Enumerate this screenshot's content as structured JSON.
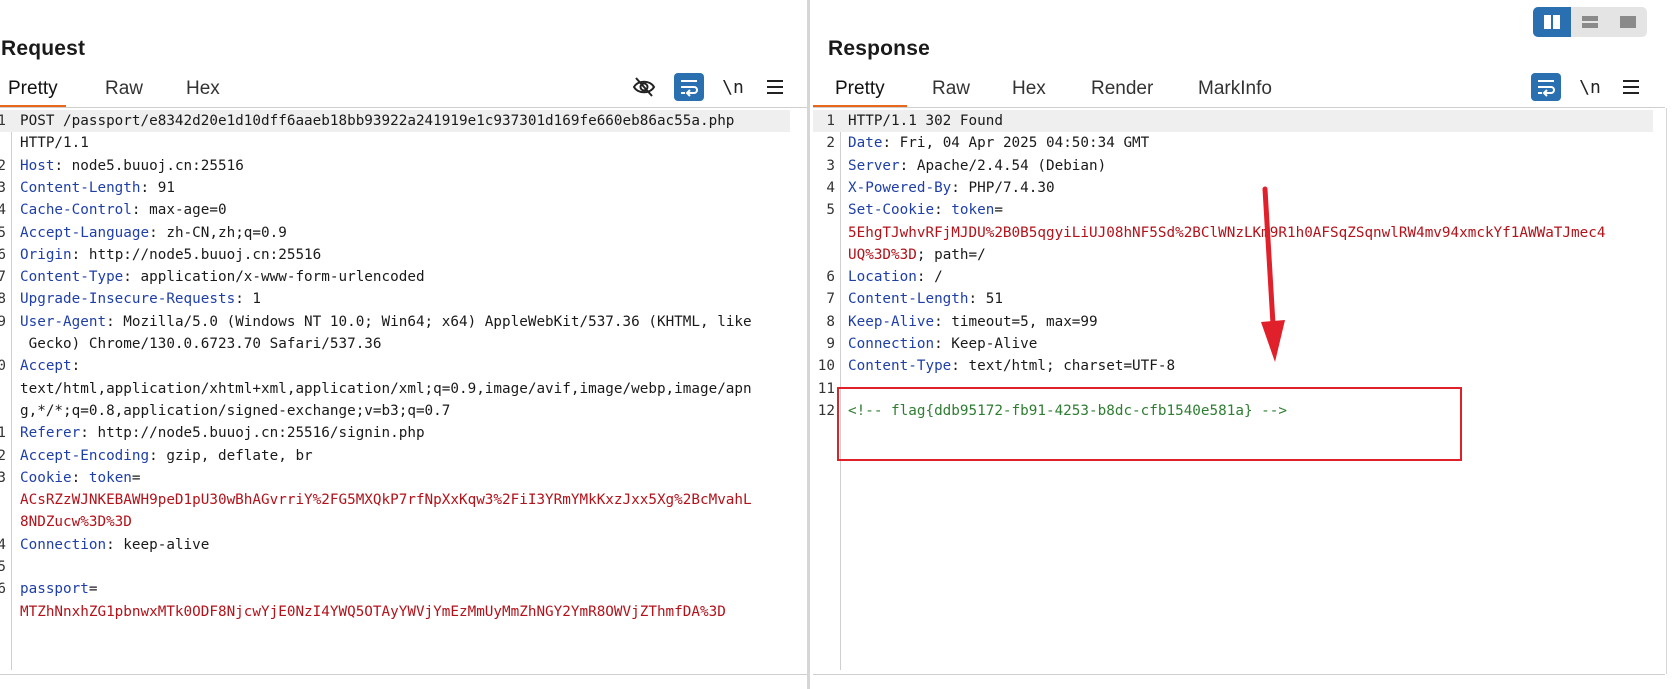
{
  "layout_controls": {
    "icons": [
      "split-vertical-icon",
      "split-horizontal-icon",
      "single-pane-icon"
    ]
  },
  "request": {
    "title": "Request",
    "tabs": [
      "Pretty",
      "Raw",
      "Hex"
    ],
    "active_tab": "Pretty",
    "tools": {
      "hide_icon": "eye-slash-icon",
      "wrap_icon": "word-wrap-icon",
      "newline_label": "\\n",
      "menu_icon": "hamburger-menu-icon"
    },
    "lines": [
      {
        "n": "1",
        "parts": [
          {
            "c": "v",
            "t": "POST /passport/e8342d20e1d10dff6aaeb18bb93922a241919e1c937301d169fe660eb86ac55a.php"
          }
        ]
      },
      {
        "n": "",
        "parts": [
          {
            "c": "v",
            "t": "HTTP/1.1"
          }
        ]
      },
      {
        "n": "2",
        "parts": [
          {
            "c": "k",
            "t": "Host"
          },
          {
            "c": "v",
            "t": ": node5.buuoj.cn:25516"
          }
        ]
      },
      {
        "n": "3",
        "parts": [
          {
            "c": "k",
            "t": "Content-Length"
          },
          {
            "c": "v",
            "t": ": 91"
          }
        ]
      },
      {
        "n": "4",
        "parts": [
          {
            "c": "k",
            "t": "Cache-Control"
          },
          {
            "c": "v",
            "t": ": max-age=0"
          }
        ]
      },
      {
        "n": "5",
        "parts": [
          {
            "c": "k",
            "t": "Accept-Language"
          },
          {
            "c": "v",
            "t": ": zh-CN,zh;q=0.9"
          }
        ]
      },
      {
        "n": "6",
        "parts": [
          {
            "c": "k",
            "t": "Origin"
          },
          {
            "c": "v",
            "t": ": http://node5.buuoj.cn:25516"
          }
        ]
      },
      {
        "n": "7",
        "parts": [
          {
            "c": "k",
            "t": "Content-Type"
          },
          {
            "c": "v",
            "t": ": application/x-www-form-urlencoded"
          }
        ]
      },
      {
        "n": "8",
        "parts": [
          {
            "c": "k",
            "t": "Upgrade-Insecure-Requests"
          },
          {
            "c": "v",
            "t": ": 1"
          }
        ]
      },
      {
        "n": "9",
        "parts": [
          {
            "c": "k",
            "t": "User-Agent"
          },
          {
            "c": "v",
            "t": ": Mozilla/5.0 (Windows NT 10.0; Win64; x64) AppleWebKit/537.36 (KHTML, like"
          }
        ]
      },
      {
        "n": "",
        "parts": [
          {
            "c": "v",
            "t": " Gecko) Chrome/130.0.6723.70 Safari/537.36"
          }
        ]
      },
      {
        "n": "10",
        "parts": [
          {
            "c": "k",
            "t": "Accept"
          },
          {
            "c": "v",
            "t": ":"
          }
        ]
      },
      {
        "n": "",
        "parts": [
          {
            "c": "v",
            "t": "text/html,application/xhtml+xml,application/xml;q=0.9,image/avif,image/webp,image/apn"
          }
        ]
      },
      {
        "n": "",
        "parts": [
          {
            "c": "v",
            "t": "g,*/*;q=0.8,application/signed-exchange;v=b3;q=0.7"
          }
        ]
      },
      {
        "n": "11",
        "parts": [
          {
            "c": "k",
            "t": "Referer"
          },
          {
            "c": "v",
            "t": ": http://node5.buuoj.cn:25516/signin.php"
          }
        ]
      },
      {
        "n": "12",
        "parts": [
          {
            "c": "k",
            "t": "Accept-Encoding"
          },
          {
            "c": "v",
            "t": ": gzip, deflate, br"
          }
        ]
      },
      {
        "n": "13",
        "parts": [
          {
            "c": "k",
            "t": "Cookie"
          },
          {
            "c": "v",
            "t": ": "
          },
          {
            "c": "k",
            "t": "token"
          },
          {
            "c": "v",
            "t": "="
          }
        ]
      },
      {
        "n": "",
        "parts": [
          {
            "c": "r",
            "t": "ACsRZzWJNKEBAWH9peD1pU30wBhAGvrriY%2FG5MXQkP7rfNpXxKqw3%2FiI3YRmYMkKxzJxx5Xg%2BcMvahL"
          }
        ]
      },
      {
        "n": "",
        "parts": [
          {
            "c": "r",
            "t": "8NDZucw%3D%3D"
          }
        ]
      },
      {
        "n": "14",
        "parts": [
          {
            "c": "k",
            "t": "Connection"
          },
          {
            "c": "v",
            "t": ": keep-alive"
          }
        ]
      },
      {
        "n": "15",
        "parts": []
      },
      {
        "n": "16",
        "parts": [
          {
            "c": "k",
            "t": "passport"
          },
          {
            "c": "v",
            "t": "="
          }
        ]
      },
      {
        "n": "",
        "parts": [
          {
            "c": "r",
            "t": "MTZhNnxhZG1pbnwxMTk0ODF8NjcwYjE0NzI4YWQ5OTAyYWVjYmEzMmUyMmZhNGY2YmR8OWVjZThmfDA%3D"
          }
        ]
      }
    ]
  },
  "response": {
    "title": "Response",
    "tabs": [
      "Pretty",
      "Raw",
      "Hex",
      "Render",
      "MarkInfo"
    ],
    "active_tab": "Pretty",
    "tools": {
      "wrap_icon": "word-wrap-icon",
      "newline_label": "\\n",
      "menu_icon": "hamburger-menu-icon"
    },
    "lines": [
      {
        "n": "1",
        "parts": [
          {
            "c": "v",
            "t": "HTTP/1.1 302 Found"
          }
        ]
      },
      {
        "n": "2",
        "parts": [
          {
            "c": "k",
            "t": "Date"
          },
          {
            "c": "v",
            "t": ": Fri, 04 Apr 2025 04:50:34 GMT"
          }
        ]
      },
      {
        "n": "3",
        "parts": [
          {
            "c": "k",
            "t": "Server"
          },
          {
            "c": "v",
            "t": ": Apache/2.4.54 (Debian)"
          }
        ]
      },
      {
        "n": "4",
        "parts": [
          {
            "c": "k",
            "t": "X-Powered-By"
          },
          {
            "c": "v",
            "t": ": PHP/7.4.30"
          }
        ]
      },
      {
        "n": "5",
        "parts": [
          {
            "c": "k",
            "t": "Set-Cookie"
          },
          {
            "c": "v",
            "t": ": "
          },
          {
            "c": "k",
            "t": "token"
          },
          {
            "c": "v",
            "t": "="
          }
        ]
      },
      {
        "n": "",
        "parts": [
          {
            "c": "r",
            "t": "5EhgTJwhvRFjMJDU%2B0B5qgyiLiUJ08hNF5Sd%2BClWNzLKm9R1h0AFSqZSqnwlRW4mv94xmckYf1AWWaTJmec4"
          }
        ]
      },
      {
        "n": "",
        "parts": [
          {
            "c": "r",
            "t": "UQ%3D%3D"
          },
          {
            "c": "v",
            "t": "; path=/"
          }
        ]
      },
      {
        "n": "6",
        "parts": [
          {
            "c": "k",
            "t": "Location"
          },
          {
            "c": "v",
            "t": ": /"
          }
        ]
      },
      {
        "n": "7",
        "parts": [
          {
            "c": "k",
            "t": "Content-Length"
          },
          {
            "c": "v",
            "t": ": 51"
          }
        ]
      },
      {
        "n": "8",
        "parts": [
          {
            "c": "k",
            "t": "Keep-Alive"
          },
          {
            "c": "v",
            "t": ": timeout=5, max=99"
          }
        ]
      },
      {
        "n": "9",
        "parts": [
          {
            "c": "k",
            "t": "Connection"
          },
          {
            "c": "v",
            "t": ": Keep-Alive"
          }
        ]
      },
      {
        "n": "10",
        "parts": [
          {
            "c": "k",
            "t": "Content-Type"
          },
          {
            "c": "v",
            "t": ": text/html; charset=UTF-8"
          }
        ]
      },
      {
        "n": "11",
        "parts": []
      },
      {
        "n": "12",
        "parts": [
          {
            "c": "g",
            "t": "<!-- flag{ddb95172-fb91-4253-b8dc-cfb1540e581a} -->"
          }
        ]
      }
    ]
  },
  "annotations": {
    "highlight_color": "#e0202a"
  }
}
